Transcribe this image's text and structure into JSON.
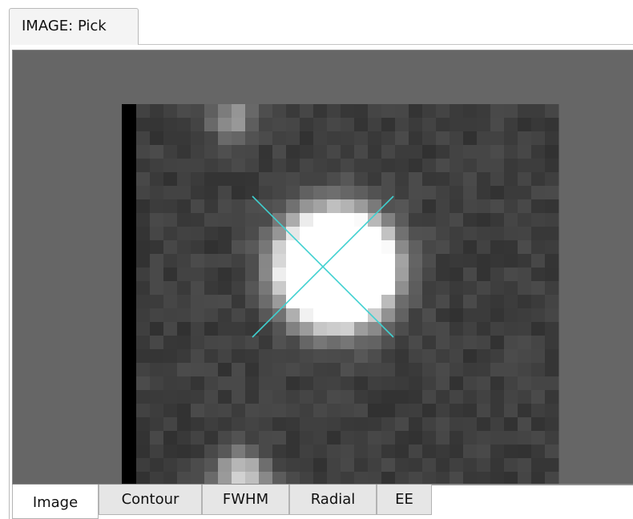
{
  "top_tab": {
    "label": "IMAGE: Pick"
  },
  "viewer": {
    "background": "#666666",
    "marker_color": "#3fd0d0",
    "marker_shape": "x-cross"
  },
  "bottom_tabs": [
    {
      "label": "Image",
      "active": true
    },
    {
      "label": "Contour",
      "active": false
    },
    {
      "label": "FWHM",
      "active": false
    },
    {
      "label": "Radial",
      "active": false
    },
    {
      "label": "EE",
      "active": false
    }
  ]
}
